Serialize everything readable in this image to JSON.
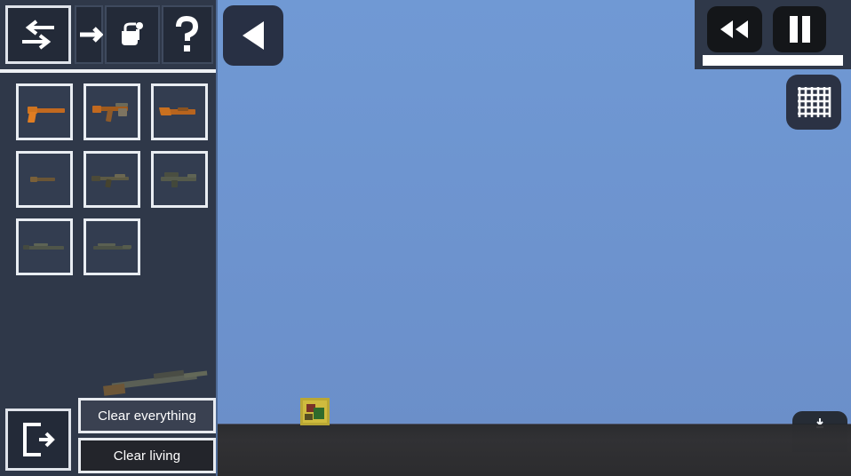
{
  "app": {
    "title": "Sandbox Weapon Spawner",
    "colors": {
      "sky": "#6f96d1",
      "ground": "#2b2c2f",
      "panel": "#2f3849",
      "slot": "#333d50",
      "border_light": "#e9edf2",
      "button_dark": "#23252b",
      "accent_white": "#ffffff"
    }
  },
  "panel": {
    "tabs": [
      {
        "id": "swap",
        "icon": "swap-arrows-icon",
        "label": "Swap",
        "selected": true
      },
      {
        "id": "arrow",
        "icon": "arrow-right-icon",
        "label": "Spawn",
        "selected": false
      },
      {
        "id": "bucket",
        "icon": "paint-bucket-icon",
        "label": "Paint",
        "selected": false
      },
      {
        "id": "help",
        "icon": "question-mark-icon",
        "label": "Help",
        "selected": false
      }
    ],
    "grid": {
      "rows": [
        [
          {
            "name": "pistol",
            "icon": "pistol-icon",
            "tint": "#c2691f"
          },
          {
            "name": "submachine-gun",
            "icon": "smg-icon",
            "tint": "#b2621f"
          },
          {
            "name": "shotgun",
            "icon": "shotgun-icon",
            "tint": "#c06a22"
          }
        ],
        [
          {
            "name": "revolver",
            "icon": "revolver-icon",
            "tint": "#6a5536"
          },
          {
            "name": "assault-rifle",
            "icon": "assault-rifle-icon",
            "tint": "#5d5a44"
          },
          {
            "name": "machine-gun",
            "icon": "machine-gun-icon",
            "tint": "#555a4b"
          }
        ],
        [
          {
            "name": "sniper-rifle",
            "icon": "sniper-rifle-icon",
            "tint": "#4f5549"
          },
          {
            "name": "battle-rifle",
            "icon": "battle-rifle-icon",
            "tint": "#4b5146"
          }
        ]
      ]
    },
    "exit_button": {
      "icon": "exit-door-icon",
      "label": "Exit"
    },
    "clear_buttons": [
      {
        "id": "clear-everything",
        "label": "Clear everything"
      },
      {
        "id": "clear-living",
        "label": "Clear living"
      }
    ],
    "dragged_item": {
      "name": "dragged-weapon",
      "label": "Sniper rifle"
    }
  },
  "overlay": {
    "back_button": {
      "icon": "triangle-left-icon",
      "label": "Collapse panel"
    },
    "rewind_button": {
      "icon": "rewind-icon",
      "label": "Rewind"
    },
    "pause_button": {
      "icon": "pause-icon",
      "label": "Pause"
    },
    "speed_slider": {
      "name": "speed-slider",
      "value": 100,
      "max": 100
    },
    "grid_button": {
      "icon": "grid-icon",
      "label": "Toggle grid"
    },
    "download_button": {
      "icon": "download-icon",
      "label": "Save"
    }
  },
  "world": {
    "entity": {
      "name": "spawned-entity",
      "label": "Crate"
    }
  }
}
